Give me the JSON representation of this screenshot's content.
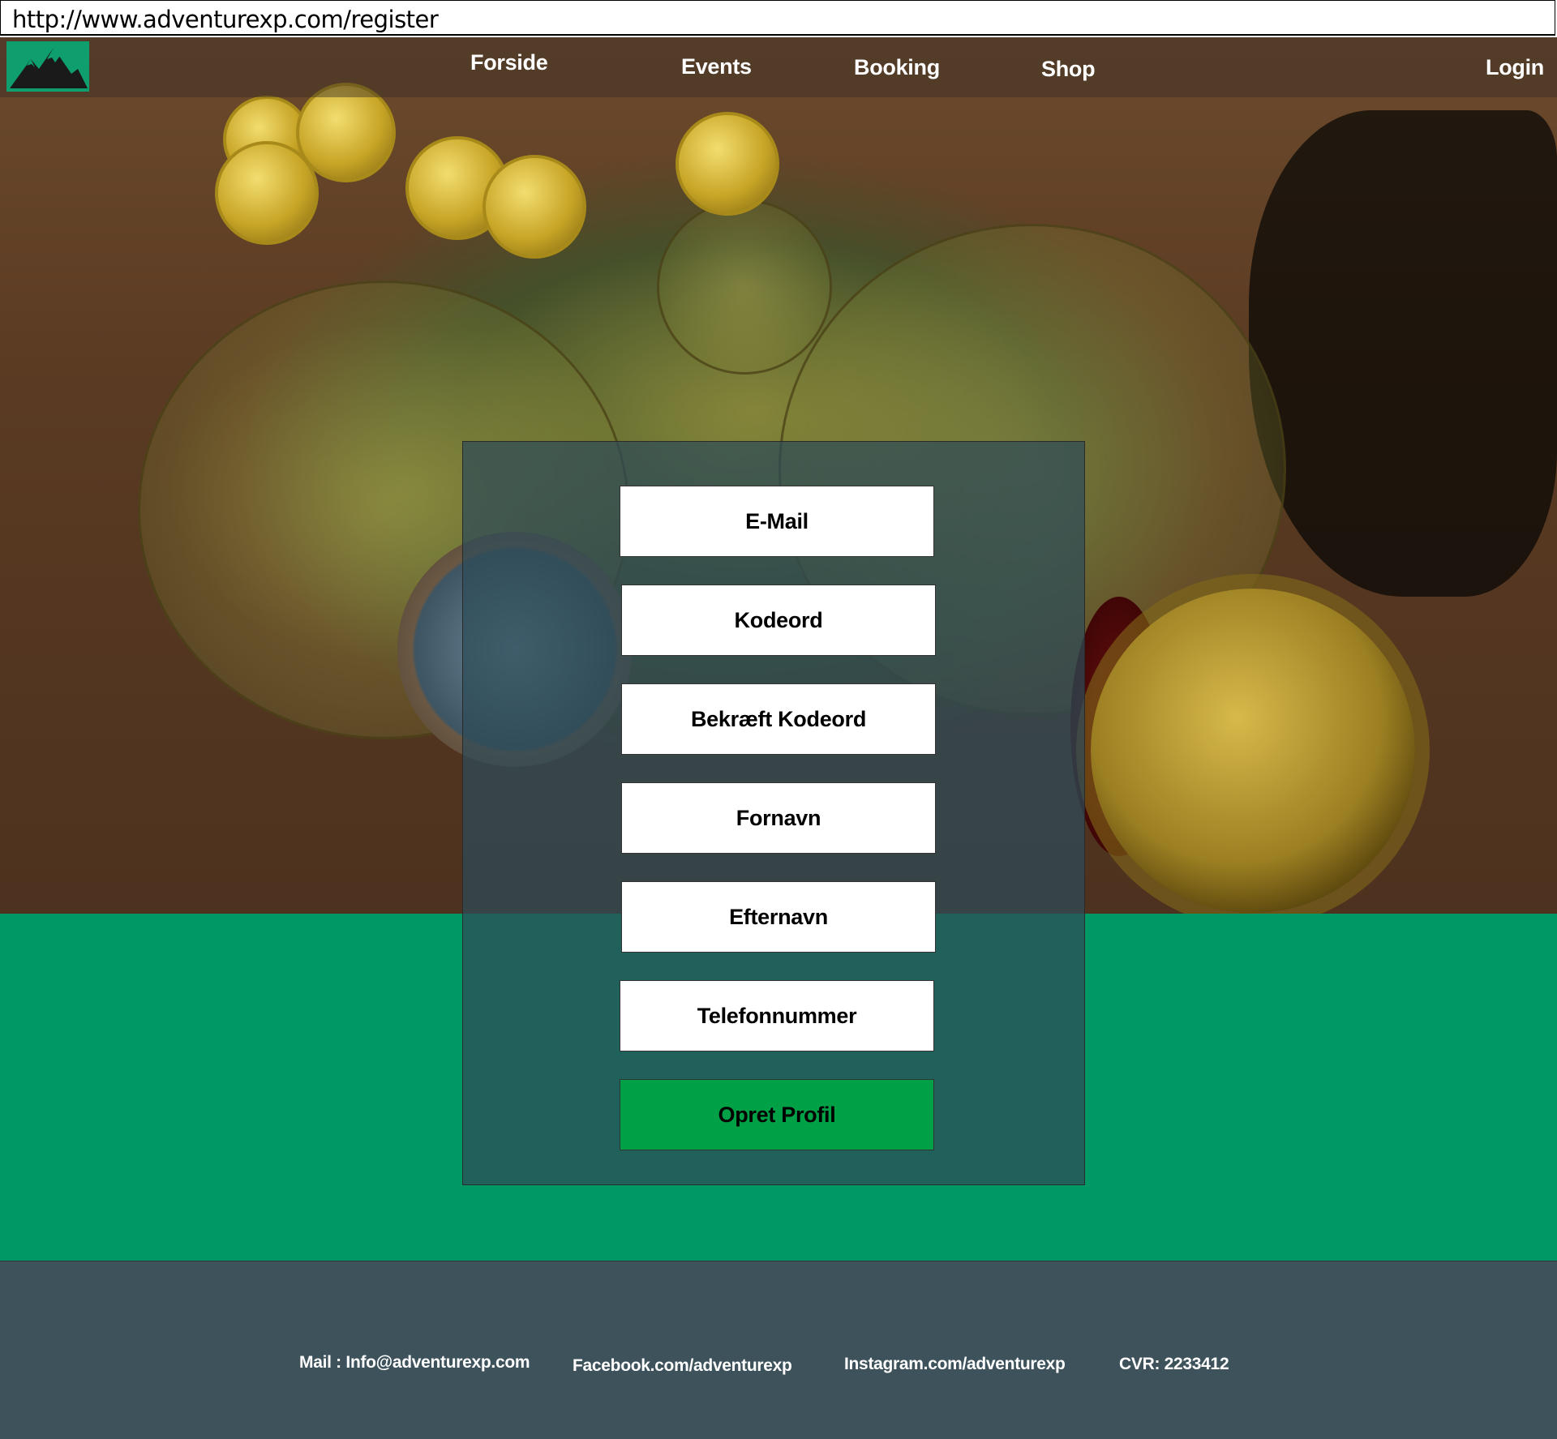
{
  "browser": {
    "url": "http://www.adventurexp.com/register"
  },
  "nav": {
    "logo_icon": "mountain-logo-icon",
    "items": [
      {
        "label": "Forside"
      },
      {
        "label": "Events"
      },
      {
        "label": "Booking"
      },
      {
        "label": "Shop"
      }
    ],
    "login_label": "Login"
  },
  "form": {
    "fields": [
      {
        "placeholder": "E-Mail"
      },
      {
        "placeholder": "Kodeord"
      },
      {
        "placeholder": "Bekræft Kodeord"
      },
      {
        "placeholder": "Fornavn"
      },
      {
        "placeholder": "Efternavn"
      },
      {
        "placeholder": "Telefonnummer"
      }
    ],
    "submit_label": "Opret Profil"
  },
  "footer": {
    "mail": "Mail : Info@adventurexp.com",
    "facebook": "Facebook.com/adventurexp",
    "instagram": "Instagram.com/adventurexp",
    "cvr": "CVR: 2233412"
  },
  "colors": {
    "logo_bg": "#0f9e6e",
    "band_green": "#009966",
    "footer_bg": "#3d525b",
    "submit_green": "#00a046",
    "panel_overlay": "#2e4b58"
  }
}
